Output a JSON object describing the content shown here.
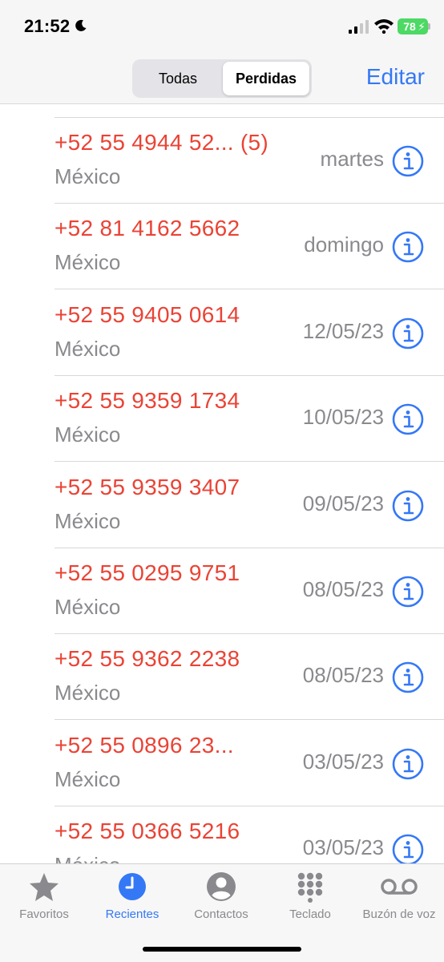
{
  "status": {
    "time": "21:52",
    "battery": "78"
  },
  "header": {
    "segments": [
      "Todas",
      "Perdidas"
    ],
    "selected_segment": "Perdidas",
    "edit_label": "Editar"
  },
  "calls": [
    {
      "number": "+52 55 4944 52... (5)",
      "location": "México",
      "date": "martes"
    },
    {
      "number": "+52 81 4162 5662",
      "location": "México",
      "date": "domingo"
    },
    {
      "number": "+52 55 9405 0614",
      "location": "México",
      "date": "12/05/23"
    },
    {
      "number": "+52 55 9359 1734",
      "location": "México",
      "date": "10/05/23"
    },
    {
      "number": "+52 55 9359 3407",
      "location": "México",
      "date": "09/05/23"
    },
    {
      "number": "+52 55 0295 9751",
      "location": "México",
      "date": "08/05/23"
    },
    {
      "number": "+52 55 9362 2238",
      "location": "México",
      "date": "08/05/23"
    },
    {
      "number": "+52 55 0896 23...",
      "location": "México",
      "date": "03/05/23"
    },
    {
      "number": "+52 55 0366 5216",
      "location": "México",
      "date": "03/05/23"
    }
  ],
  "tabbar": {
    "items": [
      {
        "label": "Favoritos",
        "icon": "star-icon"
      },
      {
        "label": "Recientes",
        "icon": "clock-icon"
      },
      {
        "label": "Contactos",
        "icon": "person-icon"
      },
      {
        "label": "Teclado",
        "icon": "keypad-icon"
      },
      {
        "label": "Buzón de voz",
        "icon": "voicemail-icon"
      }
    ],
    "active": "Recientes"
  },
  "colors": {
    "accent": "#3478f6",
    "missed": "#ea4335",
    "secondary": "#8a8a8e",
    "battery": "#4cd964"
  }
}
